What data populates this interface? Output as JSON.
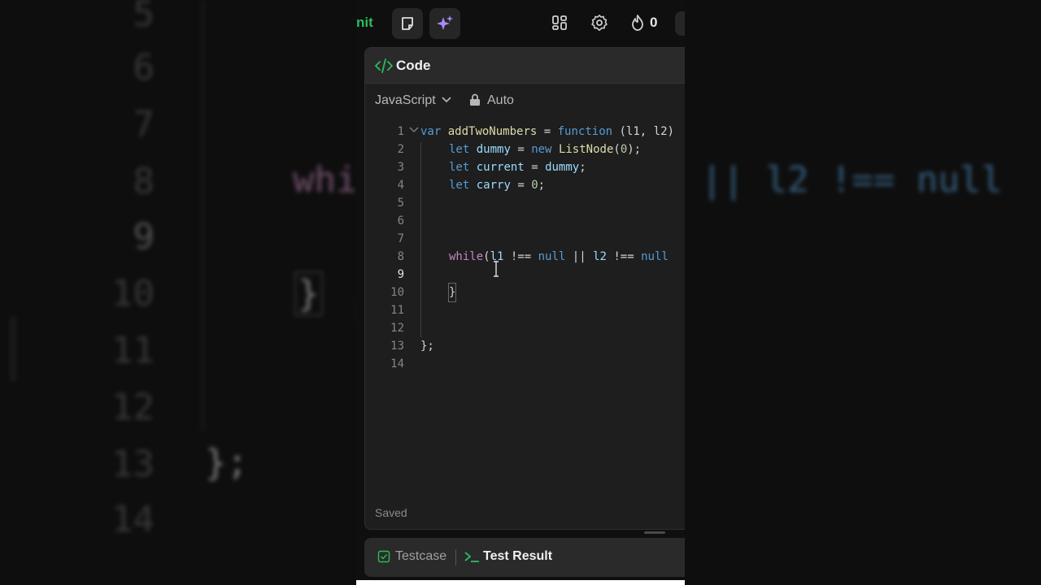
{
  "toolbar": {
    "submit_label": "nit",
    "notes_icon": "note-icon",
    "ai_icon": "sparkle-icon",
    "layout_icon": "layout-grid-icon",
    "settings_icon": "gear-icon",
    "streak_icon": "flame-icon",
    "streak_count": "0"
  },
  "editor": {
    "title": "Code",
    "language": "JavaScript",
    "mode": "Auto",
    "status": "Saved",
    "active_line": 9,
    "line_numbers": [
      "1",
      "2",
      "3",
      "4",
      "5",
      "6",
      "7",
      "8",
      "9",
      "10",
      "11",
      "12",
      "13",
      "14"
    ],
    "lines": {
      "l1": {
        "t1": "var",
        "t2": "addTwoNumbers",
        "t3": "=",
        "t4": "function",
        "t5": "(l1, l2)"
      },
      "l2": {
        "t1": "let",
        "t2": "dummy",
        "t3": "=",
        "t4": "new",
        "t5": "ListNode",
        "t6": "(",
        "t7": "0",
        "t8": ");"
      },
      "l3": {
        "t1": "let",
        "t2": "current",
        "t3": "=",
        "t4": "dummy",
        "t5": ";"
      },
      "l4": {
        "t1": "let",
        "t2": "carry",
        "t3": "=",
        "t4": "0",
        "t5": ";"
      },
      "l8": {
        "t1": "while",
        "t2": "(",
        "t3": "l1",
        "t4": "!==",
        "t5": "null",
        "t6": "||",
        "t7": "l2",
        "t8": "!==",
        "t9": "null"
      },
      "l10": "}",
      "l13": "};"
    }
  },
  "bottom_tabs": {
    "testcase": "Testcase",
    "test_result": "Test Result"
  },
  "background": {
    "line_numbers": [
      "5",
      "6",
      "7",
      "8",
      "9",
      "10",
      "11",
      "12",
      "13",
      "14"
    ],
    "snippet_left": "whi",
    "snippet_right": "|| l2 !== null",
    "brace": "}",
    "close": "};"
  },
  "colors": {
    "accent_green": "#2cbb5d",
    "ai_purple": "#a78bfa",
    "keyword": "#569cd6",
    "control": "#c586c0",
    "function": "#dcdcaa"
  }
}
